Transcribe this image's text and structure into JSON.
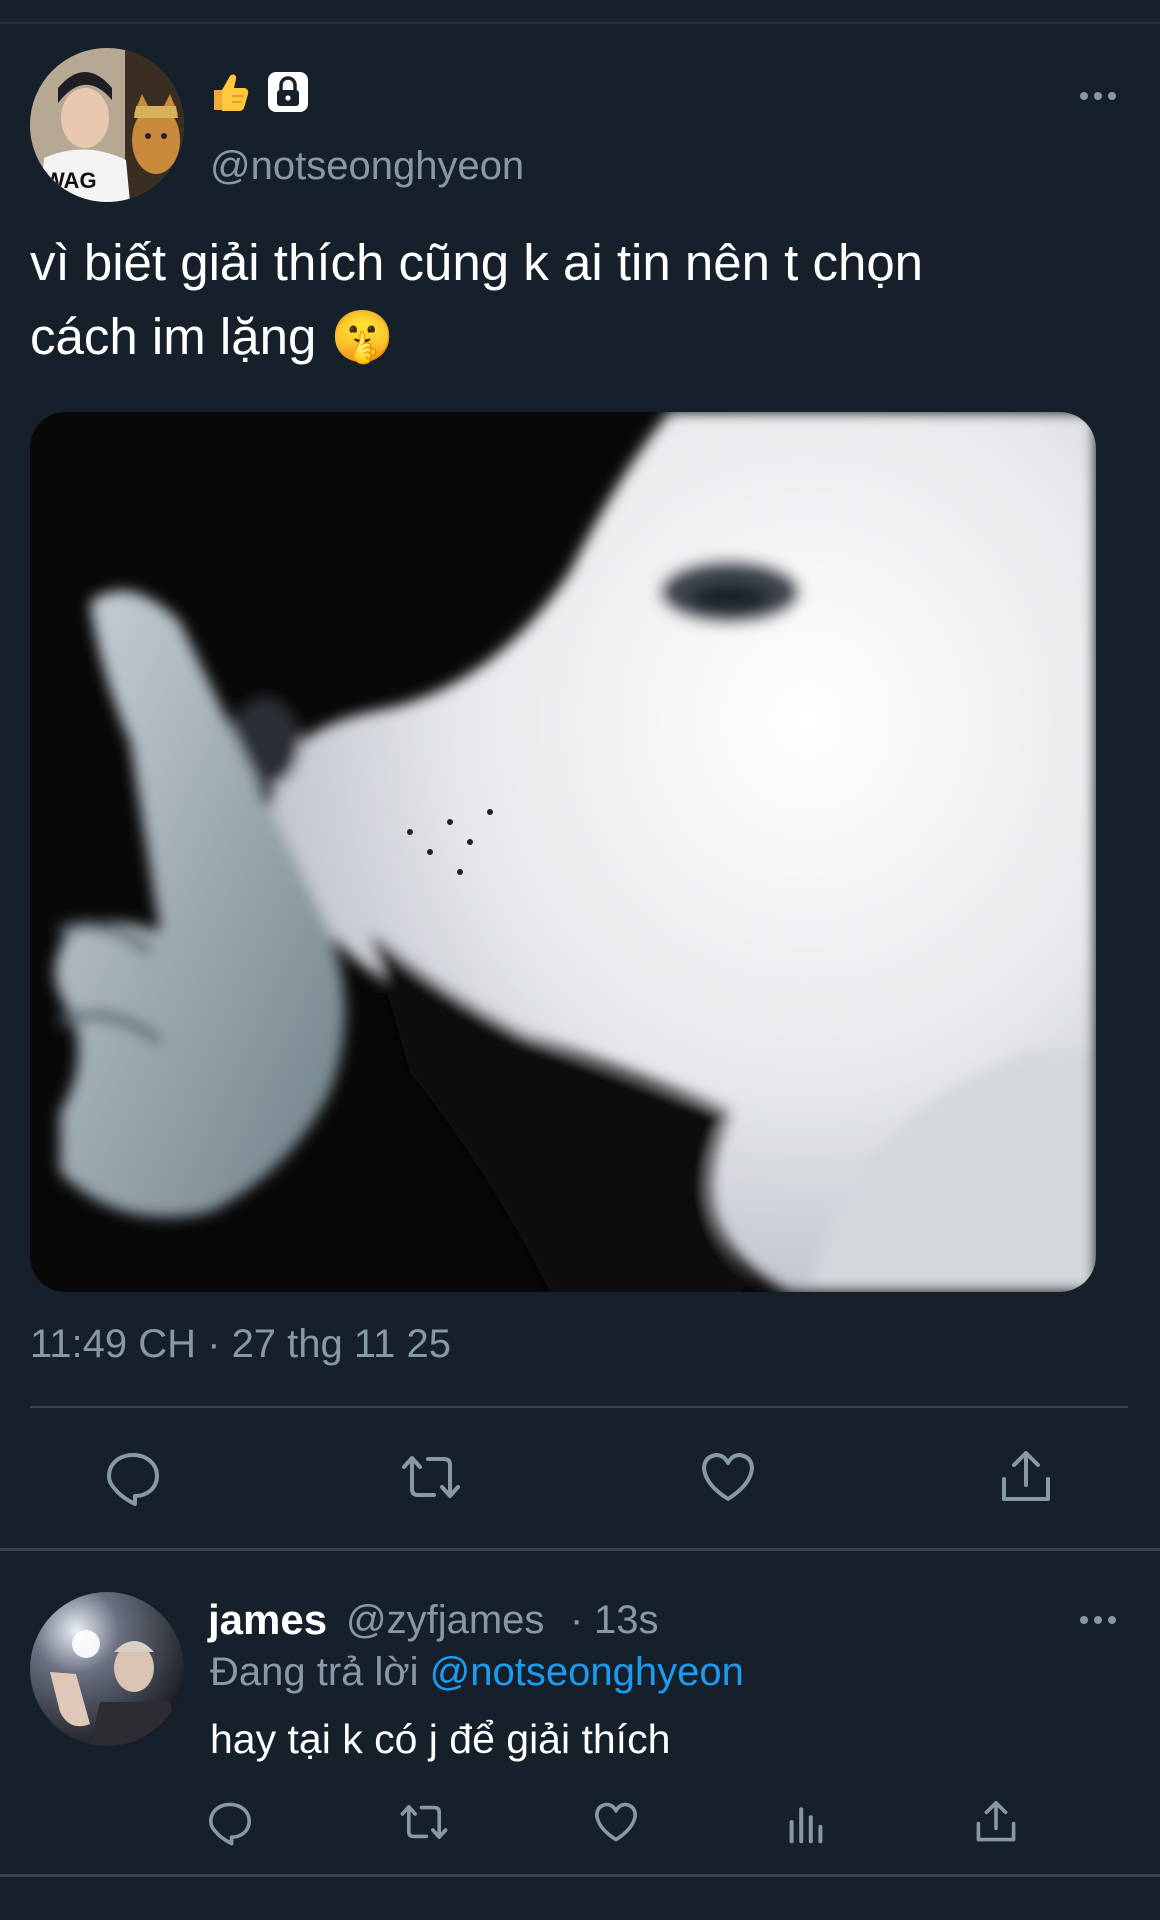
{
  "tweet": {
    "author_emojis": [
      "👍",
      "🔒"
    ],
    "handle": "@notseonghyeon",
    "text_line1": "vì biết giải thích cũng k ai tin nên t chọn",
    "text_line2": "cách im lặng 🤫",
    "timestamp": "11:49 CH · 27 thg 11 25",
    "avatar_text": "WAG",
    "actions": [
      "reply-icon",
      "retweet-icon",
      "like-icon",
      "share-icon"
    ]
  },
  "reply": {
    "name": "james",
    "handle": "@zyfjames",
    "separator": "·",
    "time": "13s",
    "replying_prefix": "Đang trả lời",
    "replying_to": "@notseonghyeon",
    "text": "hay tại k có j để giải thích",
    "actions": [
      "reply-icon",
      "retweet-icon",
      "like-icon",
      "analytics-icon",
      "share-icon"
    ]
  },
  "colors": {
    "background": "#15202b",
    "secondary_text": "#8899a6",
    "divider": "#38444d",
    "link": "#1d9bf0"
  }
}
